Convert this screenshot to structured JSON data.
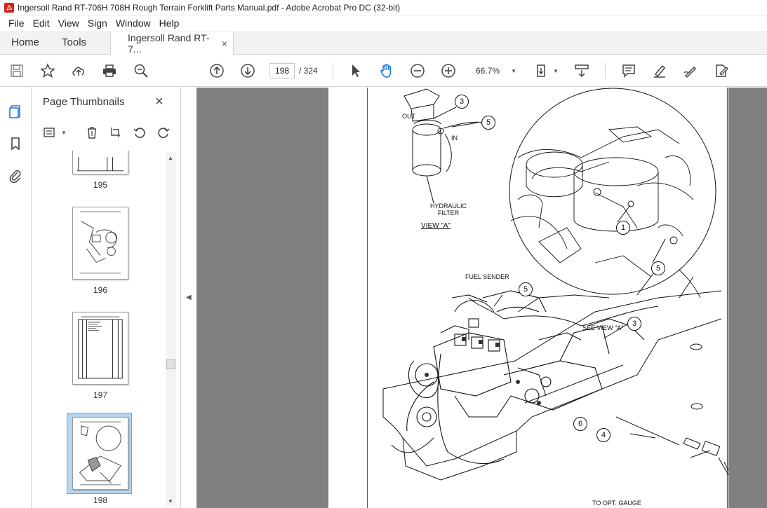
{
  "window": {
    "title": "Ingersoll Rand RT-706H 708H Rough Terrain Forklift Parts Manual.pdf - Adobe Acrobat Pro DC (32-bit)"
  },
  "menu": [
    "File",
    "Edit",
    "View",
    "Sign",
    "Window",
    "Help"
  ],
  "tabs": {
    "home": "Home",
    "tools": "Tools",
    "document": "Ingersoll Rand RT-7...",
    "close": "×"
  },
  "toolbar": {
    "current_page": "198",
    "total_pages": "/ 324",
    "zoom": "66.7%",
    "icons": [
      "save-icon",
      "star-icon",
      "upload-icon",
      "print-icon",
      "search-zoom-icon",
      "page-up-icon",
      "page-down-icon",
      "cursor-icon",
      "hand-icon",
      "zoom-out-icon",
      "zoom-in-icon",
      "fit-page-icon",
      "scroll-mode-icon",
      "comment-icon",
      "highlight-icon",
      "sign-icon",
      "fill-sign-icon"
    ]
  },
  "panel": {
    "title": "Page Thumbnails",
    "close": "×",
    "thumbnails": [
      {
        "label": "195"
      },
      {
        "label": "196"
      },
      {
        "label": "197"
      },
      {
        "label": "198",
        "selected": true
      }
    ]
  },
  "drawing": {
    "labels": {
      "out": "OUT",
      "in": "IN",
      "hydraulic_filter": "HYDRAULIC\nFILTER",
      "view_a": "VIEW \"A\"",
      "fuel_sender": "FUEL SENDER",
      "see_view_a": "SEE VIEW \"A\"",
      "to_opt_gauge": "TO OPT. GAUGE"
    },
    "callouts": [
      "3",
      "5",
      "1",
      "5",
      "5",
      "3",
      "6",
      "4"
    ]
  },
  "colors": {
    "acrobat_red": "#d8231d",
    "viewport_gray": "#808080",
    "selection_blue": "#b7d5ee"
  }
}
